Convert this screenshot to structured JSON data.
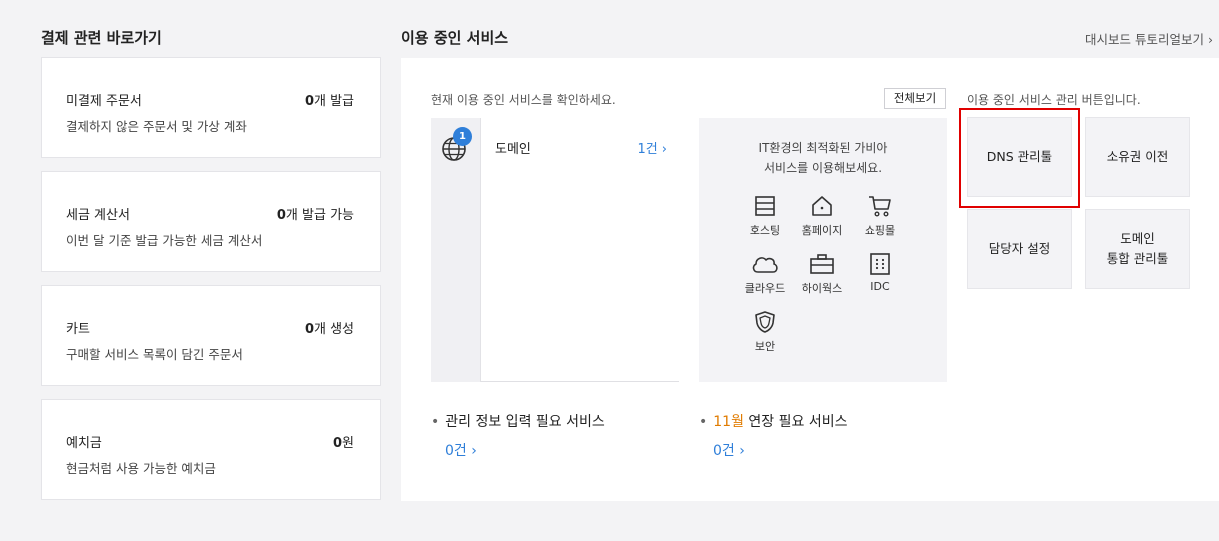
{
  "left": {
    "title": "결제 관련 바로가기",
    "cards": [
      {
        "title": "미결제 주문서",
        "value_num": "0",
        "value_unit": "개 발급",
        "desc": "결제하지 않은 주문서 및 가상 계좌"
      },
      {
        "title": "세금 계산서",
        "value_num": "0",
        "value_unit": "개 발급 가능",
        "desc": "이번 달 기준 발급 가능한 세금 계산서"
      },
      {
        "title": "카트",
        "value_num": "0",
        "value_unit": "개 생성",
        "desc": "구매할 서비스 목록이 담긴 주문서"
      },
      {
        "title": "예치금",
        "value_num": "0",
        "value_unit": "원",
        "desc": "현금처럼 사용 가능한 예치금"
      }
    ]
  },
  "services": {
    "title": "이용 중인 서비스",
    "tutorial_link": "대시보드 튜토리얼보기 ›",
    "note": "현재 이용 중인 서비스를 확인하세요.",
    "view_all": "전체보기",
    "domain": {
      "badge": "1",
      "label": "도메인",
      "count": "1건 ›"
    },
    "promo": {
      "line1": "IT환경의 최적화된 가비아",
      "line2": "서비스를 이용해보세요.",
      "items": [
        {
          "icon": "server-icon",
          "label": "호스팅"
        },
        {
          "icon": "home-icon",
          "label": "홈페이지"
        },
        {
          "icon": "cart-icon",
          "label": "쇼핑몰"
        },
        {
          "icon": "cloud-icon",
          "label": "클라우드"
        },
        {
          "icon": "briefcase-icon",
          "label": "하이웍스"
        },
        {
          "icon": "idc-icon",
          "label": "IDC"
        },
        {
          "icon": "shield-icon",
          "label": "보안"
        }
      ]
    },
    "manage_note": "이용 중인 서비스 관리 버튼입니다.",
    "manage_buttons": {
      "dns": "DNS 관리툴",
      "transfer": "소유권 이전",
      "contact": "담당자 설정",
      "domain_integrated_1": "도메인",
      "domain_integrated_2": "통합 관리툴"
    },
    "bottom": {
      "info_required": "관리 정보 입력 필요 서비스",
      "info_count": "0건 ›",
      "renew_month": "11월",
      "renew_text": " 연장 필요 서비스",
      "renew_count": "0건 ›"
    }
  },
  "colors": {
    "accent_blue": "#2f7fd9",
    "highlight_red": "#e00000",
    "month_orange": "#e07b00"
  }
}
